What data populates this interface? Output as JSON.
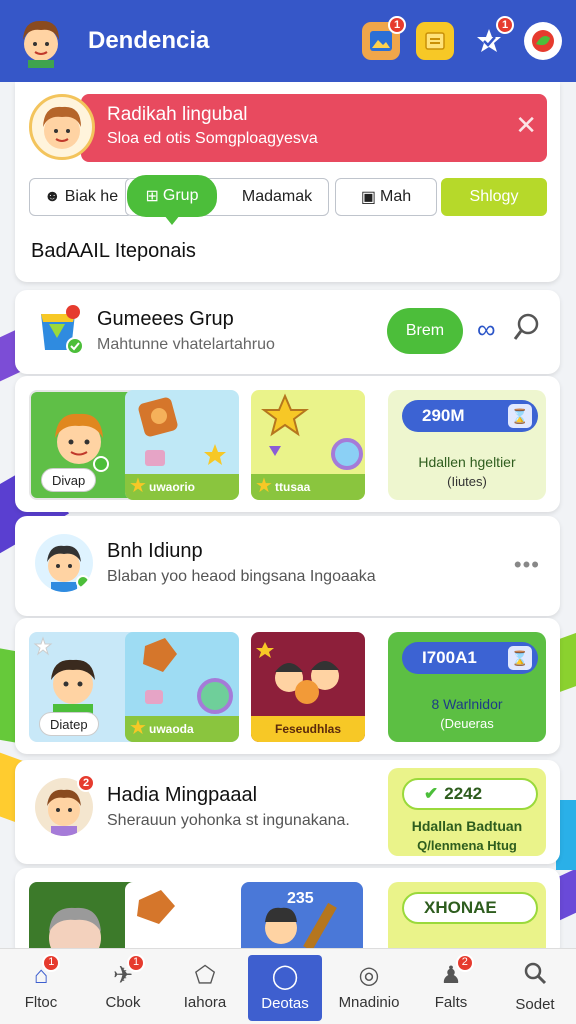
{
  "header": {
    "title": "Dendencia",
    "icons": [
      {
        "name": "photo-icon",
        "badge": "1"
      },
      {
        "name": "note-icon",
        "badge": ""
      },
      {
        "name": "star-check-icon",
        "badge": "1"
      },
      {
        "name": "chat-icon",
        "badge": ""
      }
    ]
  },
  "profile": {
    "alert_title": "Radikah lingubal",
    "alert_sub": "Sloa ed otis Somgploagyesva",
    "tabs": [
      "Biak he",
      "Grup",
      "Madamak",
      "Mah",
      "Shlogy"
    ],
    "section_heading": "BadAAIL Iteponais"
  },
  "group": {
    "title": "Gumeees Grup",
    "subtitle": "Mahtunne vhatelartahruo",
    "join_label": "Brem"
  },
  "strip1": {
    "tiles": [
      {
        "label": "Divap",
        "bar": ""
      },
      {
        "label": "",
        "bar": "uwaorio"
      },
      {
        "label": "",
        "bar": "ttusaa"
      }
    ],
    "stat": {
      "pill": "290M",
      "line1": "Hdallen hgeltier",
      "line2": "(Iiutes)"
    }
  },
  "person1": {
    "name": "Bnh Idiunp",
    "message": "Blaban yoo heaod bingsana Ingoaaka",
    "more": "•••"
  },
  "strip2": {
    "tiles": [
      {
        "label": "Diatep",
        "bar": ""
      },
      {
        "label": "",
        "bar": "uwaoda"
      },
      {
        "label": "",
        "bar": "Feseudhlas"
      }
    ],
    "stat": {
      "pill": "I700A1",
      "line1": "8 Warlnidor",
      "line2": "(Deueras"
    }
  },
  "person2": {
    "name": "Hadia Mingpaaal",
    "message": "Sherauun yohonka st ingunakana.",
    "badge": "2",
    "panel_pill": "2242",
    "panel_line1": "Hdallan Badtuan",
    "panel_line2": "Q/lenmena Htug"
  },
  "strip3": {
    "tile_text": "235",
    "pill": "XHONAE"
  },
  "nav": [
    {
      "label": "Fltoc",
      "icon": "home-icon",
      "badge": "1"
    },
    {
      "label": "Cbok",
      "icon": "plane-icon",
      "badge": "1"
    },
    {
      "label": "Iahora",
      "icon": "pentagon-icon",
      "badge": ""
    },
    {
      "label": "Deotas",
      "icon": "ball-icon",
      "badge": ""
    },
    {
      "label": "Mnadinio",
      "icon": "camera-icon",
      "badge": ""
    },
    {
      "label": "Falts",
      "icon": "user-icon",
      "badge": "2"
    },
    {
      "label": "Sodet",
      "icon": "search-icon",
      "badge": ""
    }
  ],
  "colors": {
    "header": "#3657c8",
    "alert": "#e84a5f",
    "accent_green": "#4cbe3a",
    "lime": "#b6d92a",
    "nav_active": "#3e5fcf"
  }
}
